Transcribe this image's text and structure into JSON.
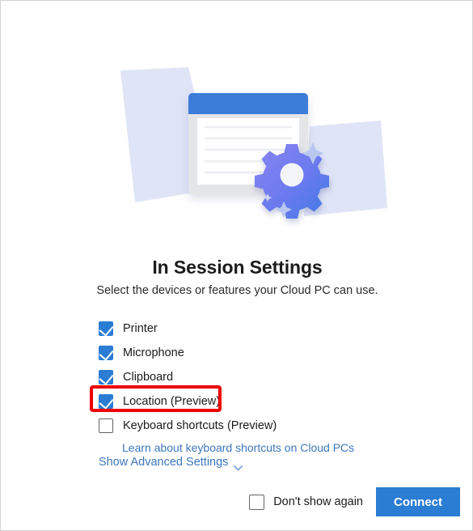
{
  "header": {
    "title": "In Session Settings",
    "subtitle": "Select the devices or features your Cloud PC can use."
  },
  "illustration": {
    "name": "settings-window-gear-illustration",
    "window_titlebar_color": "#3b7dd8",
    "backdrop_shape_color": "#dde3f7",
    "gear_gradient_from": "#7b7ff0",
    "gear_gradient_to": "#4279e4",
    "document_line_count": 5
  },
  "options": [
    {
      "label": "Printer",
      "checked": true,
      "name": "printer"
    },
    {
      "label": "Microphone",
      "checked": true,
      "name": "microphone"
    },
    {
      "label": "Clipboard",
      "checked": true,
      "name": "clipboard"
    },
    {
      "label": "Location (Preview)",
      "checked": true,
      "name": "location"
    },
    {
      "label": "Keyboard shortcuts (Preview)",
      "checked": false,
      "name": "keyboard-shortcuts"
    }
  ],
  "keyboard_help_link": "Learn about keyboard shortcuts on Cloud PCs",
  "advanced": {
    "label": "Show Advanced Settings",
    "icon": "chevron-down-icon"
  },
  "footer": {
    "dont_show_again_label": "Don't show again",
    "dont_show_again_checked": false,
    "connect_label": "Connect"
  },
  "annotation": {
    "type": "highlight-rectangle",
    "color": "#ee0000",
    "targets": "Location (Preview)"
  },
  "colors": {
    "accent": "#2b7cd3",
    "link": "#3c77bd",
    "annotation_red": "#ee0000",
    "text": "#1b1b1b"
  }
}
